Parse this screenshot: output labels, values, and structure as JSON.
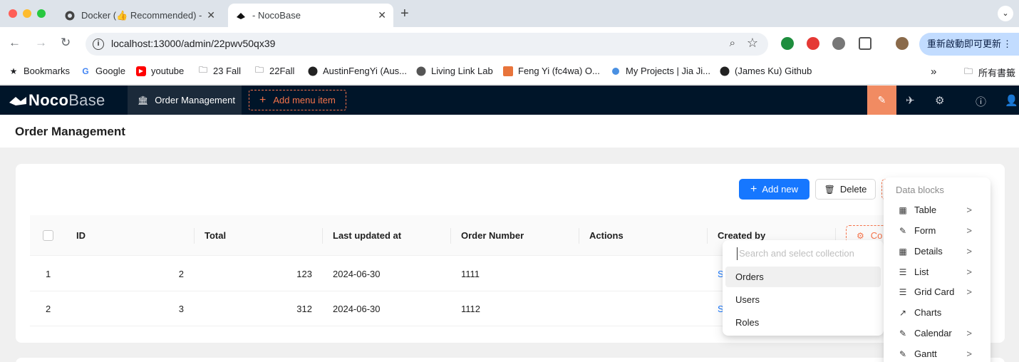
{
  "browser": {
    "tabs": [
      {
        "title": "Docker (👍 Recommended) -",
        "active": false
      },
      {
        "title": "- NocoBase",
        "active": true
      }
    ],
    "url": "localhost:13000/admin/22pwv50qx39",
    "update_button": "重新啟動即可更新",
    "bookmarks": [
      {
        "label": "Bookmarks",
        "icon": "star-icon"
      },
      {
        "label": "Google",
        "icon": "google-icon"
      },
      {
        "label": "youtube",
        "icon": "youtube-icon"
      },
      {
        "label": "23 Fall",
        "icon": "folder-icon"
      },
      {
        "label": "22Fall",
        "icon": "folder-icon"
      },
      {
        "label": "AustinFengYi (Aus...",
        "icon": "github-icon"
      },
      {
        "label": "Living Link Lab",
        "icon": "globe-icon"
      },
      {
        "label": "Feng Yi (fc4wa) O...",
        "icon": "building-icon"
      },
      {
        "label": "My Projects | Jia Ji...",
        "icon": "dot-icon"
      },
      {
        "label": "(James Ku) Github",
        "icon": "github-icon"
      }
    ],
    "all_bookmarks": "所有書籤"
  },
  "app": {
    "logo_bold": "Noco",
    "logo_light": "Base",
    "active_menu": "Order Management",
    "add_menu_item": "Add menu item"
  },
  "page": {
    "title": "Order Management",
    "actions": {
      "add_new": "Add new",
      "delete": "Delete",
      "configure": "Co"
    },
    "table": {
      "columns": [
        "ID",
        "Total",
        "Last updated at",
        "Order Number",
        "Actions",
        "Created by"
      ],
      "rows": [
        {
          "index": "1",
          "id": "2",
          "total": "123",
          "updated": "2024-06-30",
          "order_number": "1111",
          "created_by": "S"
        },
        {
          "index": "2",
          "id": "3",
          "total": "312",
          "updated": "2024-06-30",
          "order_number": "1112",
          "created_by": "S"
        }
      ]
    }
  },
  "collection_dropdown": {
    "placeholder": "Search and select collection",
    "options": [
      "Orders",
      "Users",
      "Roles"
    ],
    "highlighted": "Orders"
  },
  "data_blocks_menu": {
    "group_title": "Data blocks",
    "items": [
      {
        "label": "Table",
        "icon": "table-icon",
        "has_submenu": true
      },
      {
        "label": "Form",
        "icon": "form-icon",
        "has_submenu": true
      },
      {
        "label": "Details",
        "icon": "details-icon",
        "has_submenu": true
      },
      {
        "label": "List",
        "icon": "list-icon",
        "has_submenu": true
      },
      {
        "label": "Grid Card",
        "icon": "grid-card-icon",
        "has_submenu": true
      },
      {
        "label": "Charts",
        "icon": "chart-icon",
        "has_submenu": false
      },
      {
        "label": "Calendar",
        "icon": "calendar-icon",
        "has_submenu": true
      },
      {
        "label": "Gantt",
        "icon": "gantt-icon",
        "has_submenu": true
      }
    ]
  },
  "colors": {
    "primary": "#1677ff",
    "accent": "#f5734a",
    "header_bg": "#001529"
  }
}
